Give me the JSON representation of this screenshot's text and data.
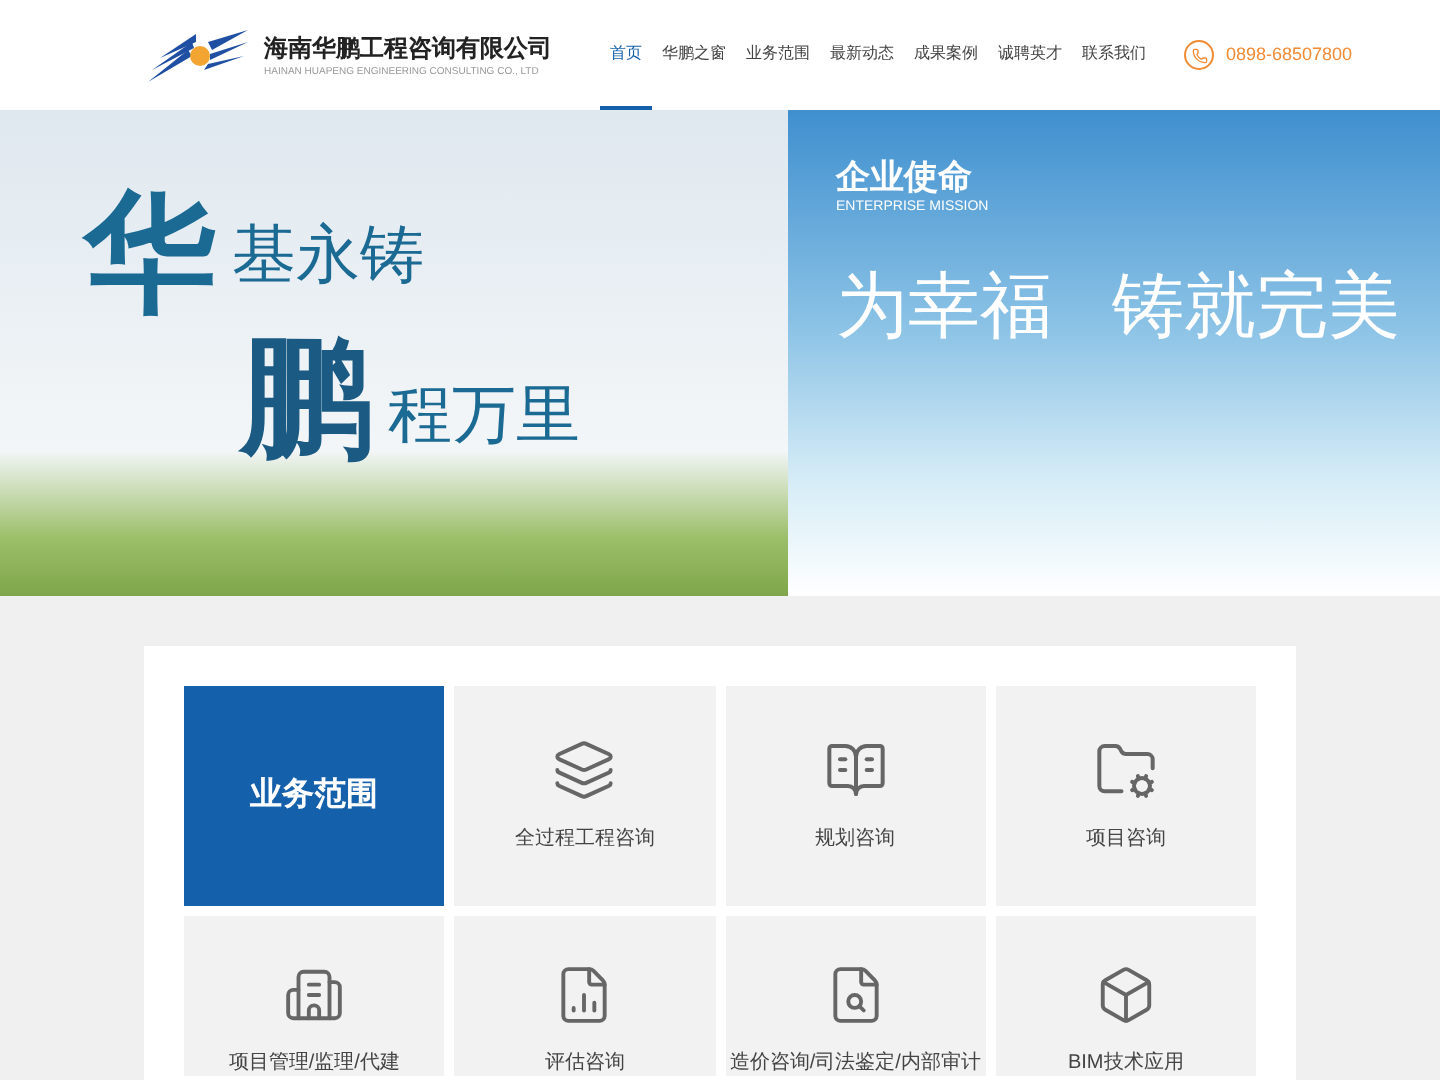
{
  "header": {
    "company_name": "海南华鹏工程咨询有限公司",
    "company_name_en": "HAINAN HUAPENG ENGINEERING CONSULTING CO., LTD",
    "nav": [
      {
        "label": "首页",
        "selected": true
      },
      {
        "label": "华鹏之窗",
        "selected": false
      },
      {
        "label": "业务范围",
        "selected": false
      },
      {
        "label": "最新动态",
        "selected": false
      },
      {
        "label": "成果案例",
        "selected": false
      },
      {
        "label": "诚聘英才",
        "selected": false
      },
      {
        "label": "联系我们",
        "selected": false
      }
    ],
    "phone": "0898-68507800"
  },
  "banner": {
    "left": {
      "big_1": "华",
      "line_1": "基永铸",
      "big_2": "鹏",
      "line_2": "程万里"
    },
    "right": {
      "title": "企业使命",
      "subtitle": "ENTERPRISE MISSION",
      "slogan_1": "为幸福",
      "slogan_2": "铸就完美"
    }
  },
  "services": [
    {
      "kind": "heading",
      "label": "业务范围"
    },
    {
      "kind": "service",
      "label": "全过程工程咨询"
    },
    {
      "kind": "service",
      "label": "规划咨询"
    },
    {
      "kind": "service",
      "label": "项目咨询"
    },
    {
      "kind": "service",
      "label": "项目管理/监理/代建"
    },
    {
      "kind": "service",
      "label": "评估咨询"
    },
    {
      "kind": "service",
      "label": "造价咨询/司法鉴定/内部审计"
    },
    {
      "kind": "service",
      "label": "BIM技术应用"
    }
  ]
}
